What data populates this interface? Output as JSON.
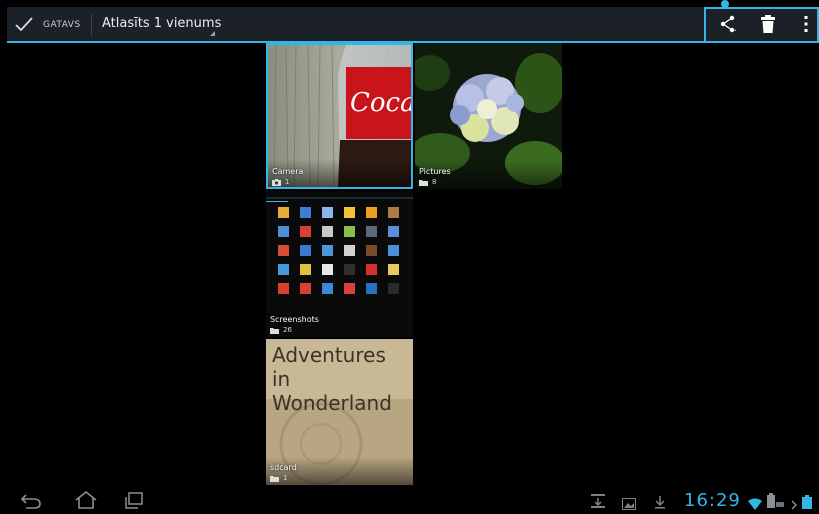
{
  "actionbar": {
    "done_label": "GATAVS",
    "selection_title": "Atlasīts 1 vienums",
    "accent": "#33b5e5"
  },
  "albums": [
    {
      "name": "Camera",
      "count": "1",
      "type_icon": "camera-icon",
      "selected": true
    },
    {
      "name": "Pictures",
      "count": "8",
      "type_icon": "folder-icon",
      "selected": false
    },
    {
      "name": "Screenshots",
      "count": "26",
      "type_icon": "folder-icon",
      "selected": false
    },
    {
      "name": "sdcard",
      "count": "1",
      "type_icon": "folder-icon",
      "selected": false
    }
  ],
  "sdcard_thumb": {
    "line1": "Adventures",
    "line2": "in Wonderland"
  },
  "status": {
    "time": "16:29"
  }
}
